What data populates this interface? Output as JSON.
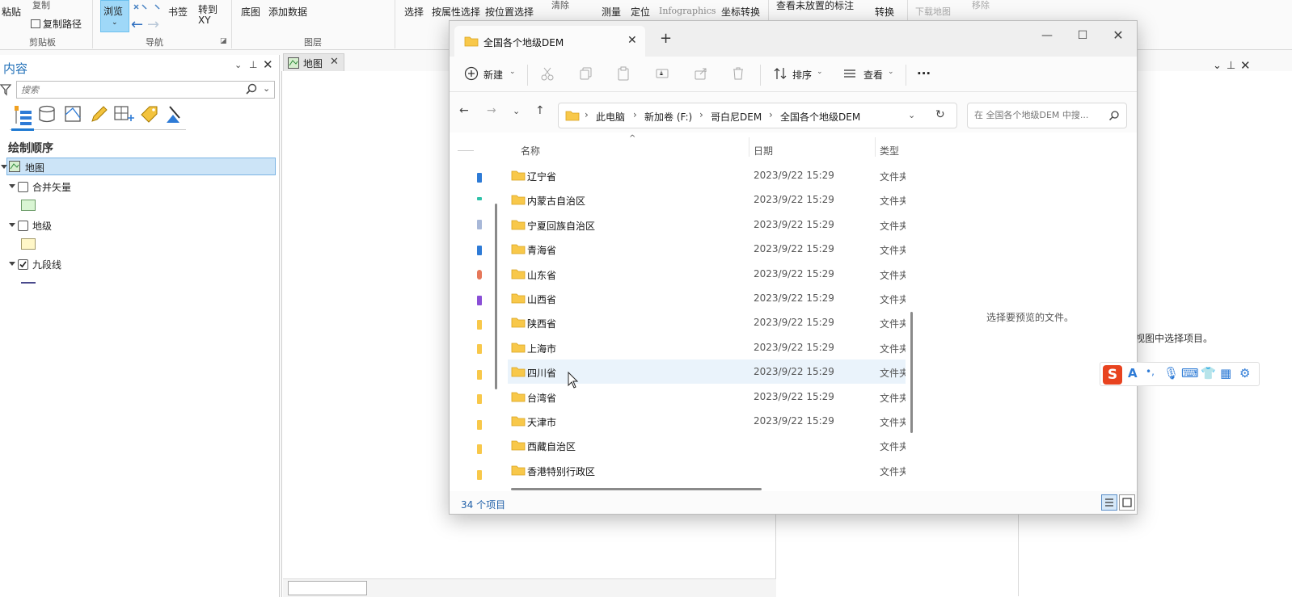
{
  "ribbon": {
    "paste": "粘贴",
    "copy": "复制",
    "copy_path": "复制路径",
    "group_clipboard": "剪贴板",
    "browse": "浏览",
    "bookmark": "书签",
    "goto_xy": "转到XY",
    "group_nav": "导航",
    "basemap": "底图",
    "add_data": "添加数据",
    "group_layer": "图层",
    "select": "选择",
    "select_by_attr": "按属性选择",
    "select_by_loc": "按位置选择",
    "clear": "清除",
    "measure": "测量",
    "locate": "定位",
    "infographics": "Infographics",
    "coord_convert": "坐标转换",
    "view_unplaced": "查看未放置的标注",
    "convert": "转换",
    "download_map": "下载地图",
    "remove": "移除"
  },
  "contents": {
    "title": "内容",
    "search_placeholder": "搜索",
    "draw_order": "绘制顺序",
    "layers": [
      {
        "name": "地图",
        "checked": null
      },
      {
        "name": "合并矢量",
        "checked": false,
        "color": "#d9f5d3"
      },
      {
        "name": "地级",
        "checked": false,
        "color": "#fff7c8"
      },
      {
        "name": "九段线",
        "checked": true,
        "color": "#4a4a8c"
      }
    ]
  },
  "map_tab": {
    "label": "地图"
  },
  "right_pane": {
    "hint": "视图中选择项目。"
  },
  "explorer": {
    "tab_title": "全国各个地级DEM",
    "new_tab": "+",
    "toolbar": {
      "new": "新建",
      "sort": "排序",
      "view": "查看",
      "more": "···"
    },
    "breadcrumbs": [
      "此电脑",
      "新加卷 (F:)",
      "哥白尼DEM",
      "全国各个地级DEM"
    ],
    "search_placeholder": "在 全国各个地级DEM 中搜...",
    "columns": {
      "name": "名称",
      "date": "日期",
      "type": "类型"
    },
    "files": [
      {
        "name": "辽宁省",
        "date": "2023/9/22 15:29",
        "type": "文件夹"
      },
      {
        "name": "内蒙古自治区",
        "date": "2023/9/22 15:29",
        "type": "文件夹"
      },
      {
        "name": "宁夏回族自治区",
        "date": "2023/9/22 15:29",
        "type": "文件夹"
      },
      {
        "name": "青海省",
        "date": "2023/9/22 15:29",
        "type": "文件夹"
      },
      {
        "name": "山东省",
        "date": "2023/9/22 15:29",
        "type": "文件夹"
      },
      {
        "name": "山西省",
        "date": "2023/9/22 15:29",
        "type": "文件夹"
      },
      {
        "name": "陕西省",
        "date": "2023/9/22 15:29",
        "type": "文件夹"
      },
      {
        "name": "上海市",
        "date": "2023/9/22 15:29",
        "type": "文件夹"
      },
      {
        "name": "四川省",
        "date": "2023/9/22 15:29",
        "type": "文件夹"
      },
      {
        "name": "台湾省",
        "date": "2023/9/22 15:29",
        "type": "文件夹"
      },
      {
        "name": "天津市",
        "date": "2023/9/22 15:29",
        "type": "文件夹"
      },
      {
        "name": "西藏自治区",
        "date": "",
        "type": "文件夹"
      },
      {
        "name": "香港特别行政区",
        "date": "",
        "type": "文件夹"
      }
    ],
    "hover_index": 8,
    "preview_hint": "选择要预览的文件。",
    "status": "34 个项目"
  },
  "colors": {
    "accent": "#1f7ad2",
    "folder": "#f8c84a",
    "ime_logo": "#e8431f"
  }
}
